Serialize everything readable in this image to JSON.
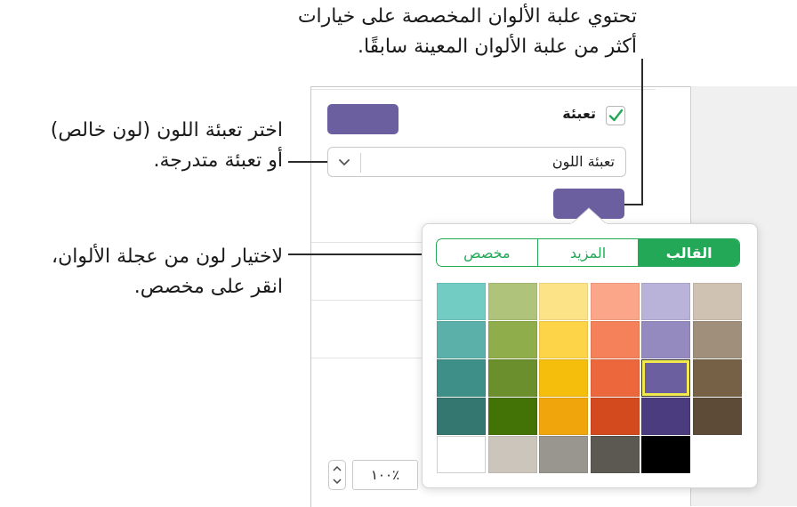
{
  "callouts": {
    "top": [
      "تحتوي علبة الألوان المخصصة على خيارات",
      "أكثر من علبة الألوان المعينة سابقًا."
    ],
    "left": [
      "اختر تعبئة اللون (لون خالص)",
      "أو تعبئة متدرجة."
    ],
    "middle": [
      "لاختيار لون من عجلة الألوان،",
      "انقر على مخصص."
    ]
  },
  "inspector": {
    "fill_label": "تعبئة",
    "fill_checked": true,
    "fill_type_value": "تعبئة اللون",
    "opacity_value": "٪١٠٠",
    "current_color": "#6b5fa0"
  },
  "palette": {
    "tabs": [
      {
        "label": "القالب",
        "active": true
      },
      {
        "label": "المزيد",
        "active": false
      },
      {
        "label": "مخصص",
        "active": false
      }
    ],
    "accent_color": "#23a857",
    "selected": {
      "row": 2,
      "col": 4
    },
    "rows": [
      [
        "#72ccc4",
        "#afc47a",
        "#fde388",
        "#fca689",
        "#b9b2d9",
        "#cfc2b2"
      ],
      [
        "#5bb1a9",
        "#8fae4b",
        "#fdd447",
        "#f5815a",
        "#958ac0",
        "#a08f7b"
      ],
      [
        "#3d8f87",
        "#6a8f2c",
        "#f5be0c",
        "#ed673d",
        "#6b5fa0",
        "#776146"
      ],
      [
        "#347670",
        "#437307",
        "#f1a50c",
        "#d44a1f",
        "#4a3c7e",
        "#5d4b37"
      ],
      [
        "#ffffff",
        "#cbc5bc",
        "#999690",
        "#5c5953",
        "#000000",
        null
      ]
    ]
  }
}
